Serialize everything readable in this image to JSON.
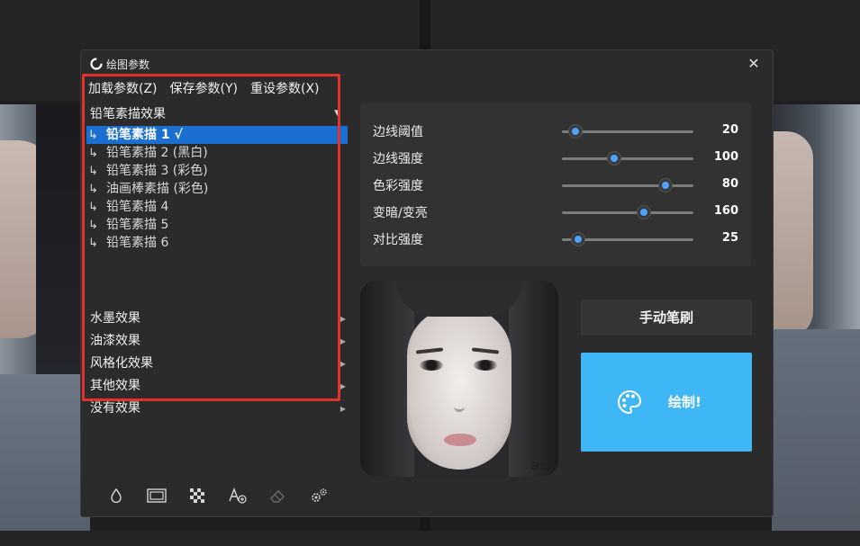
{
  "dialog": {
    "title": "绘图参数",
    "close_label": "✕"
  },
  "menu": {
    "load": "加载参数(Z)",
    "save": "保存参数(Y)",
    "reset": "重设参数(X)"
  },
  "effects": {
    "group_label": "铅笔素描效果",
    "items": [
      {
        "label": "铅笔素描 1 √",
        "selected": true
      },
      {
        "label": "铅笔素描 2 (黑白)"
      },
      {
        "label": "铅笔素描 3 (彩色)"
      },
      {
        "label": "油画棒素描 (彩色)"
      },
      {
        "label": "铅笔素描 4"
      },
      {
        "label": "铅笔素描 5"
      },
      {
        "label": "铅笔素描 6"
      }
    ],
    "categories": [
      "水墨效果",
      "油漆效果",
      "风格化效果",
      "其他效果",
      "没有效果"
    ]
  },
  "sliders": [
    {
      "label": "边线阈值",
      "value": "20",
      "position": 0.1
    },
    {
      "label": "边线强度",
      "value": "100",
      "position": 0.4
    },
    {
      "label": "色彩强度",
      "value": "80",
      "position": 0.79
    },
    {
      "label": "变暗/变亮",
      "value": "160",
      "position": 0.62
    },
    {
      "label": "对比强度",
      "value": "25",
      "position": 0.12
    }
  ],
  "buttons": {
    "manual_brush": "手动笔刷",
    "draw": "绘制!"
  },
  "preview": {
    "zoom_controls": "⊖⊕"
  },
  "colors": {
    "accent": "#3fb6f6",
    "selection": "#1a6fd0",
    "slider_knob": "#4da3ff",
    "highlight_box": "#e3322b"
  }
}
